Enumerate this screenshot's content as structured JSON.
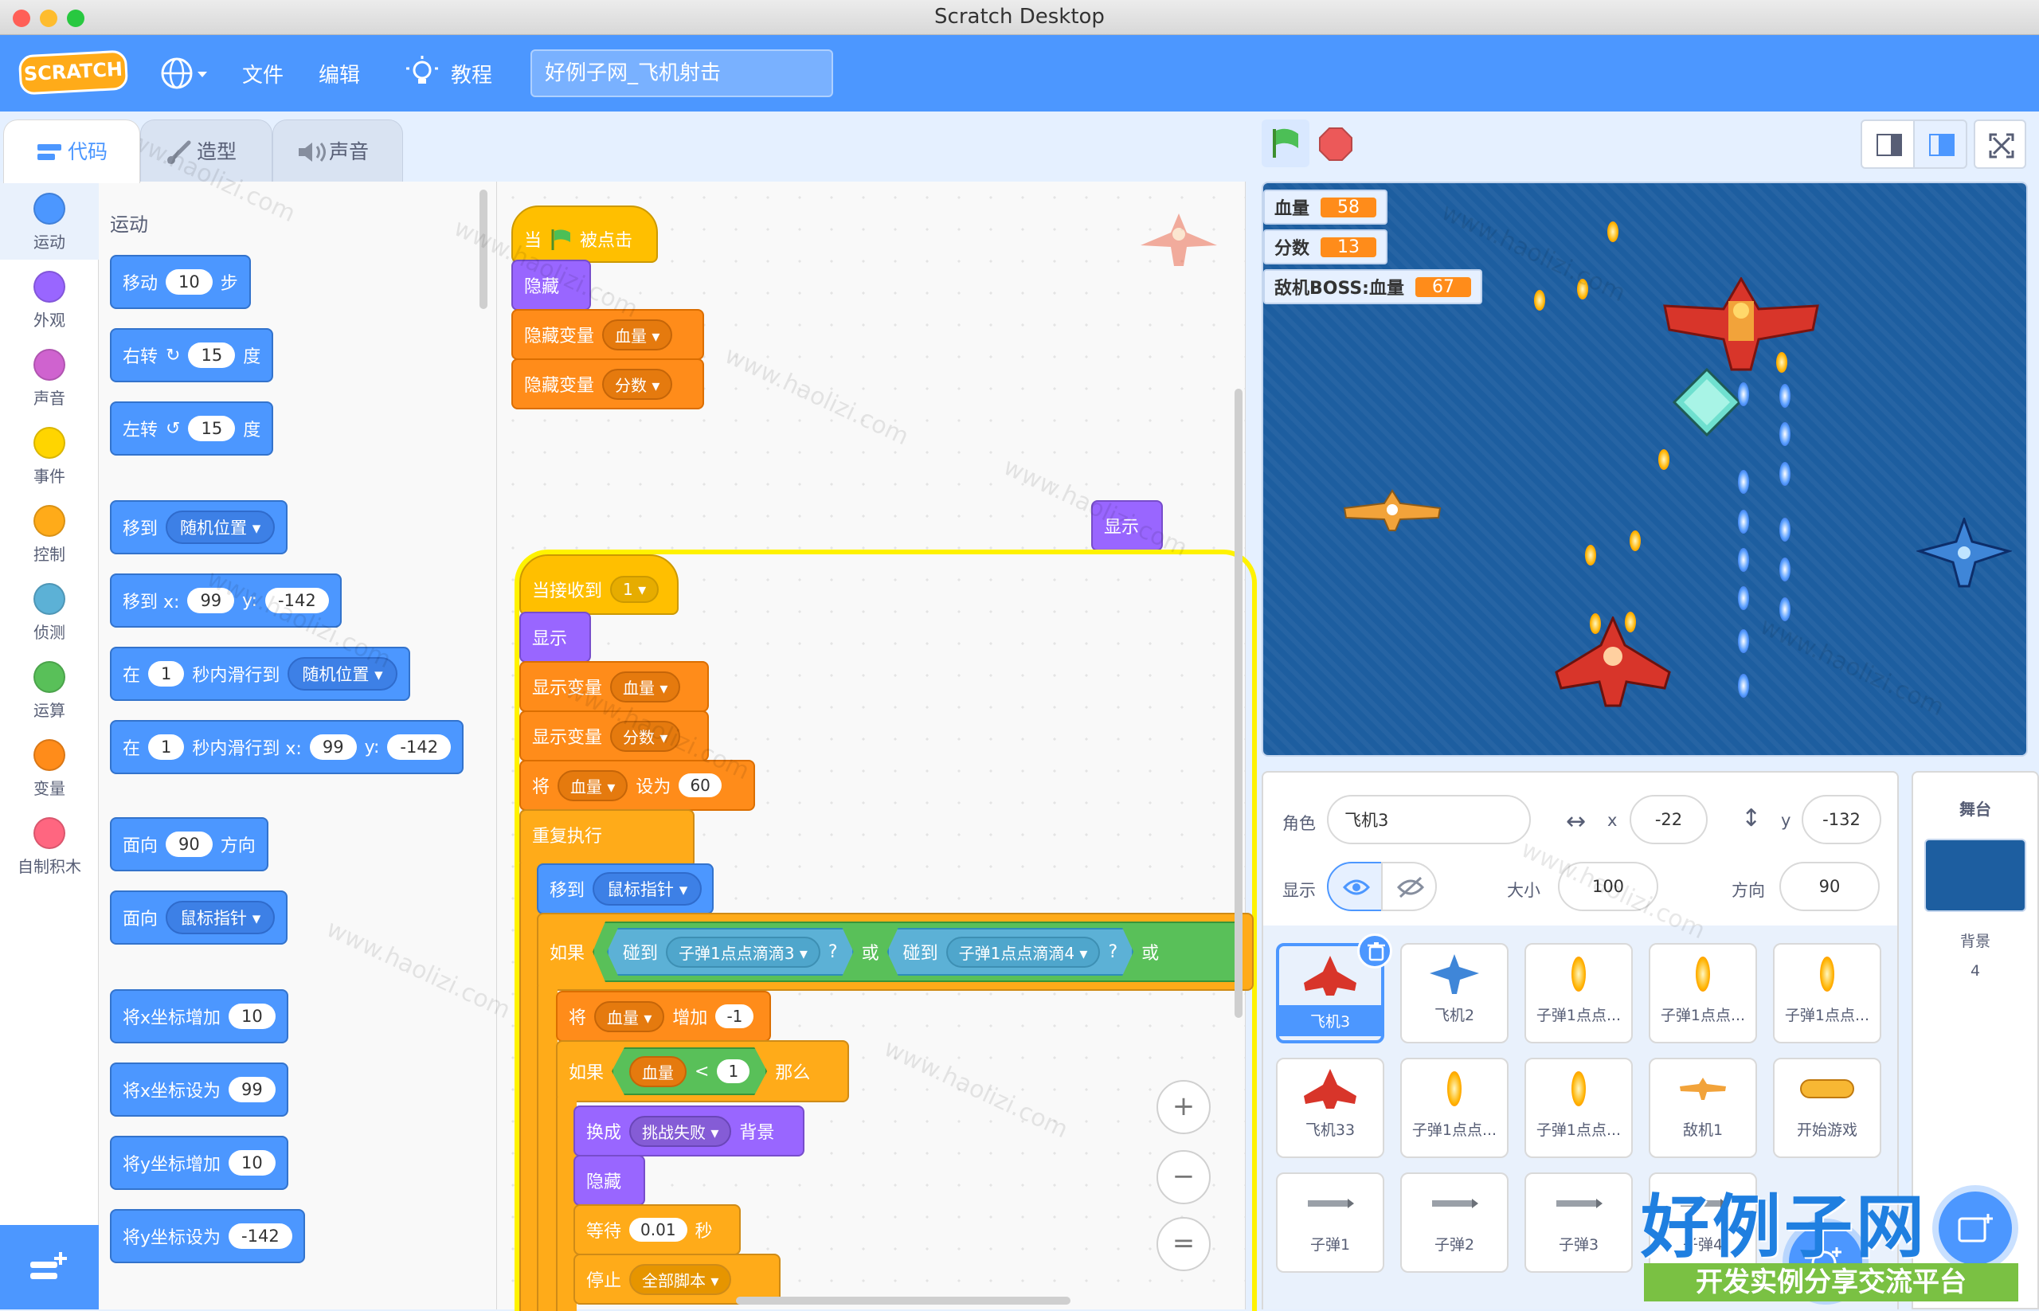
{
  "window": {
    "title": "Scratch Desktop"
  },
  "menubar": {
    "logo": "SCRATCH",
    "file": "文件",
    "edit": "编辑",
    "tutorials": "教程",
    "project_title": "好例子网_飞机射击"
  },
  "tabs": {
    "code": "代码",
    "costumes": "造型",
    "sounds": "声音"
  },
  "categories": [
    {
      "label": "运动",
      "color": "#4c97ff"
    },
    {
      "label": "外观",
      "color": "#9966ff"
    },
    {
      "label": "声音",
      "color": "#cf63cf"
    },
    {
      "label": "事件",
      "color": "#ffd500"
    },
    {
      "label": "控制",
      "color": "#ffab19"
    },
    {
      "label": "侦测",
      "color": "#5cb1d6"
    },
    {
      "label": "运算",
      "color": "#59c059"
    },
    {
      "label": "变量",
      "color": "#ff8c1a"
    },
    {
      "label": "自制积木",
      "color": "#ff6680"
    }
  ],
  "palette": {
    "heading": "运动",
    "move": {
      "t1": "移动",
      "v": "10",
      "t2": "步"
    },
    "turn_right": {
      "t1": "右转",
      "v": "15",
      "t2": "度"
    },
    "turn_left": {
      "t1": "左转",
      "v": "15",
      "t2": "度"
    },
    "goto": {
      "t1": "移到",
      "dd": "随机位置"
    },
    "goto_xy": {
      "t1": "移到 x:",
      "x": "99",
      "ty": "y:",
      "y": "-142"
    },
    "glide": {
      "t1": "在",
      "v": "1",
      "t2": "秒内滑行到",
      "dd": "随机位置"
    },
    "glide_xy": {
      "t1": "在",
      "v": "1",
      "t2": "秒内滑行到 x:",
      "x": "99",
      "ty": "y:",
      "y": "-142"
    },
    "point_dir": {
      "t1": "面向",
      "v": "90",
      "t2": "方向"
    },
    "point_towards": {
      "t1": "面向",
      "dd": "鼠标指针"
    },
    "change_x": {
      "t1": "将x坐标增加",
      "v": "10"
    },
    "set_x": {
      "t1": "将x坐标设为",
      "v": "99"
    },
    "change_y": {
      "t1": "将y坐标增加",
      "v": "10"
    },
    "set_y": {
      "t1": "将y坐标设为",
      "v": "-142"
    }
  },
  "script1": {
    "when": "当",
    "clicked": "被点击",
    "hide": "隐藏",
    "hidevar1": "隐藏变量",
    "hidevar1_dd": "血量",
    "hidevar2": "隐藏变量",
    "hidevar2_dd": "分数"
  },
  "floating_show": "显示",
  "script2": {
    "when_receive": "当接收到",
    "msg": "1",
    "show": "显示",
    "showvar1": "显示变量",
    "showvar1_dd": "血量",
    "showvar2": "显示变量",
    "showvar2_dd": "分数",
    "set": "将",
    "set_dd": "血量",
    "set_to": "设为",
    "set_val": "60",
    "forever": "重复执行",
    "goto": "移到",
    "goto_dd": "鼠标指针",
    "if": "如果",
    "touch1": "碰到",
    "touch1_dd": "子弹1点点滴滴3",
    "q1": "?",
    "or1": "或",
    "touch2": "碰到",
    "touch2_dd": "子弹1点点滴滴4",
    "q2": "?",
    "or2": "或",
    "change": "将",
    "change_dd": "血量",
    "change_by": "增加",
    "change_val": "-1",
    "if2": "如果",
    "cmp_var": "血量",
    "lt": "<",
    "cmp_val": "1",
    "then": "那么",
    "switch_bg": "换成",
    "switch_dd": "挑战失败",
    "switch_tail": "背景",
    "hide": "隐藏",
    "wait": "等待",
    "wait_val": "0.01",
    "wait_unit": "秒",
    "stop": "停止",
    "stop_dd": "全部脚本"
  },
  "zoom": {
    "in": "+",
    "out": "−",
    "reset": "="
  },
  "stage": {
    "monitors": [
      {
        "label": "血量",
        "value": "58"
      },
      {
        "label": "分数",
        "value": "13"
      },
      {
        "label": "敌机BOSS:血量",
        "value": "67"
      }
    ]
  },
  "sprite_info": {
    "sprite_label": "角色",
    "sprite_name": "飞机3",
    "x_label": "x",
    "x_val": "-22",
    "y_label": "y",
    "y_val": "-132",
    "show_label": "显示",
    "size_label": "大小",
    "size_val": "100",
    "dir_label": "方向",
    "dir_val": "90"
  },
  "sprites": [
    {
      "name": "飞机3",
      "selected": true,
      "icon": "plane-red-icon"
    },
    {
      "name": "飞机2",
      "icon": "plane-blue-icon"
    },
    {
      "name": "子弹1点点...",
      "icon": "bullet-icon"
    },
    {
      "name": "子弹1点点...",
      "icon": "bullet-icon"
    },
    {
      "name": "子弹1点点...",
      "icon": "bullet-icon"
    },
    {
      "name": "飞机33",
      "icon": "plane-red-icon"
    },
    {
      "name": "子弹1点点...",
      "icon": "bullet-icon"
    },
    {
      "name": "子弹1点点...",
      "icon": "bullet-icon"
    },
    {
      "name": "敌机1",
      "icon": "plane-orange-icon"
    },
    {
      "name": "开始游戏",
      "icon": "play-icon"
    },
    {
      "name": "子弹1",
      "icon": "missile-icon"
    },
    {
      "name": "子弹2",
      "icon": "missile-icon"
    },
    {
      "name": "子弹3",
      "icon": "missile-icon"
    },
    {
      "name": "子弹4",
      "icon": "missile-icon"
    }
  ],
  "backdrop": {
    "label": "舞台",
    "bg_label": "背景",
    "count": "4"
  },
  "watermark": {
    "site": "www.haolizi.com",
    "brand": "好例子网",
    "slogan": "开发实例分享交流平台"
  }
}
